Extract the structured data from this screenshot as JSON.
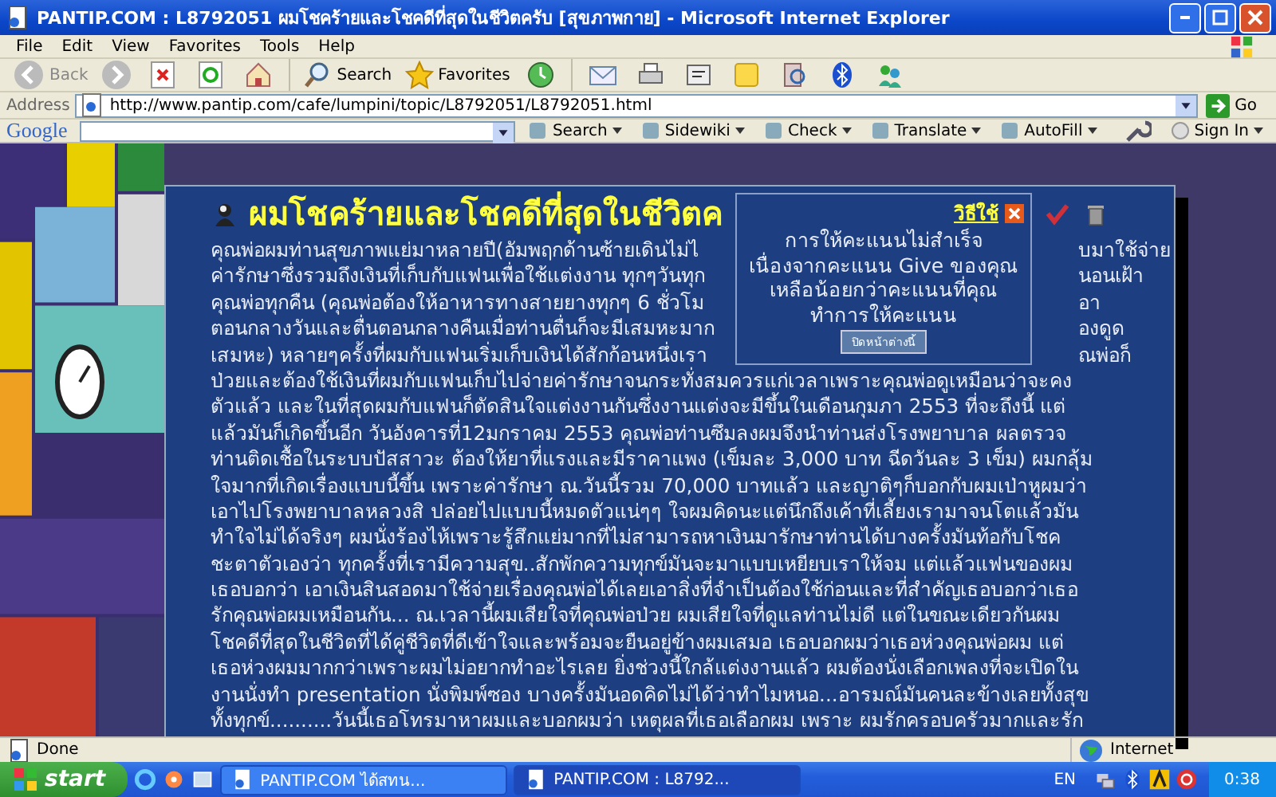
{
  "window": {
    "title": "PANTIP.COM : L8792051 ผมโชคร้ายและโชคดีที่สุดในชีวิตครับ [สุขภาพกาย] - Microsoft Internet Explorer"
  },
  "menu": [
    "File",
    "Edit",
    "View",
    "Favorites",
    "Tools",
    "Help"
  ],
  "toolbar": {
    "back": "Back",
    "search": "Search",
    "favorites": "Favorites"
  },
  "address_bar": {
    "label": "Address",
    "url": "http://www.pantip.com/cafe/lumpini/topic/L8792051/L8792051.html",
    "go": "Go"
  },
  "google_toolbar": {
    "logo": "Google",
    "items": [
      "Search",
      "Sidewiki",
      "Check",
      "Translate",
      "AutoFill"
    ],
    "sign_in": "Sign In"
  },
  "post": {
    "title": "ผมโชคร้ายและโชคดีที่สุดในชีวิตค",
    "lines": [
      [
        "คุณพ่อผมท่านสุขภาพแย่มาหลายปี(อัมพฤกด้านซ้ายเดินไม่ไ",
        "บมาใช้จ่าย"
      ],
      [
        "ค่ารักษาซึ่งรวมถึงเงินที่เก็บกับแฟนเพื่อใช้แต่งงาน ทุกๆวันทุก",
        "นอนเฝ้า"
      ],
      [
        "คุณพ่อทุกคืน (คุณพ่อต้องให้อาหารทางสายยางทุกๆ 6 ชั่วโม",
        "อา"
      ],
      [
        "ตอนกลางวันและตื่นตอนกลางคืนเมื่อท่านตื่นก็จะมีเสมหะมาก",
        "องดูด"
      ],
      [
        "เสมหะ) หลายๆครั้งที่ผมกับแฟนเริ่มเก็บเงินได้สักก้อนหนึ่งเรา",
        "ณพ่อก็"
      ],
      [
        "ป่วยและต้องใช้เงินที่ผมกับแฟนเก็บไปจ่ายค่ารักษาจนกระทั่งสมควรแก่เวลาเพราะคุณพ่อดูเหมือนว่าจะคง"
      ],
      [
        "ตัวแล้ว และในที่สุดผมกับแฟนก็ตัดสินใจแต่งงานกันซึ่งงานแต่งจะมีขึ้นในเดือนกุมภา 2553 ที่จะถึงนี้ แต่"
      ],
      [
        "แล้วมันก็เกิดขึ้นอีก วันอังคารที่12มกราคม 2553 คุณพ่อท่านซึมลงผมจึงนำท่านส่งโรงพยาบาล ผลตรวจ"
      ],
      [
        "ท่านติดเชื้อในระบบปัสสาวะ ต้องให้ยาที่แรงและมีราคาแพง (เข็มละ 3,000 บาท ฉีดวันละ 3 เข็ม) ผมกลุ้ม"
      ],
      [
        "ใจมากที่เกิดเรื่องแบบนี้ขึ้น เพราะค่ารักษา ณ.วันนี้รวม 70,000 บาทแล้ว และญาติๆก็บอกกับผมเป่าหูผมว่า"
      ],
      [
        "เอาไปโรงพยาบาลหลวงสิ ปล่อยไปแบบนี้หมดตัวแน่ๆๆ ใจผมคิดนะแต่นึกถึงเค้าที่เลี้ยงเรามาจนโตแล้วมัน"
      ],
      [
        "ทำใจไม่ได้จริงๆ ผมนั่งร้องไห้เพราะรู้สึกแย่มากที่ไม่สามารถหาเงินมารักษาท่านได้บางครั้งมันท้อกับโชค"
      ],
      [
        "ชะตาตัวเองว่า ทุกครั้งที่เรามีความสุข..สักพักความทุกข์มันจะมาแบบเหยียบเราให้จม แต่แล้วแฟนของผม"
      ],
      [
        "เธอบอกว่า เอาเงินสินสอดมาใช้จ่ายเรื่องคุณพ่อได้เลยเอาสิ่งที่จำเป็นต้องใช้ก่อนและที่สำคัญเธอบอกว่าเธอ"
      ],
      [
        "รักคุณพ่อผมเหมือนกัน... ณ.เวลานี้ผมเสียใจที่คุณพ่อป่วย ผมเสียใจที่ดูแลท่านไม่ดี แต่ในขณะเดียวกันผม"
      ],
      [
        "โชคดีที่สุดในชีวิตที่ได้คู่ชีวิตที่ดีเข้าใจและพร้อมจะยืนอยู่ข้างผมเสมอ เธอบอกผมว่าเธอห่วงคุณพ่อผม แต่"
      ],
      [
        "เธอห่วงผมมากกว่าเพราะผมไม่อยากทำอะไรเลย ยิ่งช่วงนี้ใกล้แต่งงานแล้ว ผมต้องนั่งเลือกเพลงที่จะเปิดใน"
      ],
      [
        "งานนั่งทำ presentation นั่งพิมพ์ซอง บางครั้งมันอดคิดไม่ได้ว่าทำไมหนอ...อารมณ์มันคนละข้างเลยทั้งสุข"
      ],
      [
        "ทั้งทุกข์..........วันนี้เธอโทรมาหาผมและบอกผมว่า เหตุผลที่เธอเลือกผม เพราะ ผมรักครอบครัวมากและรัก"
      ]
    ]
  },
  "popup": {
    "help_link": "วิธีใช้",
    "message": "การให้คะแนนไม่สำเร็จ เนื่องจากคะแนน Give ของคุณเหลือน้อยกว่าคะแนนที่คุณทำการให้คะแนน",
    "button": "ปิดหน้าต่างนี้"
  },
  "status_bar": {
    "status": "Done",
    "zone": "Internet"
  },
  "taskbar": {
    "start": "start",
    "windows": [
      {
        "label": "PANTIP.COM ได้สทน...",
        "selected": false
      },
      {
        "label": "PANTIP.COM : L8792...",
        "selected": true
      }
    ],
    "language": "EN",
    "clock": "0:38"
  }
}
